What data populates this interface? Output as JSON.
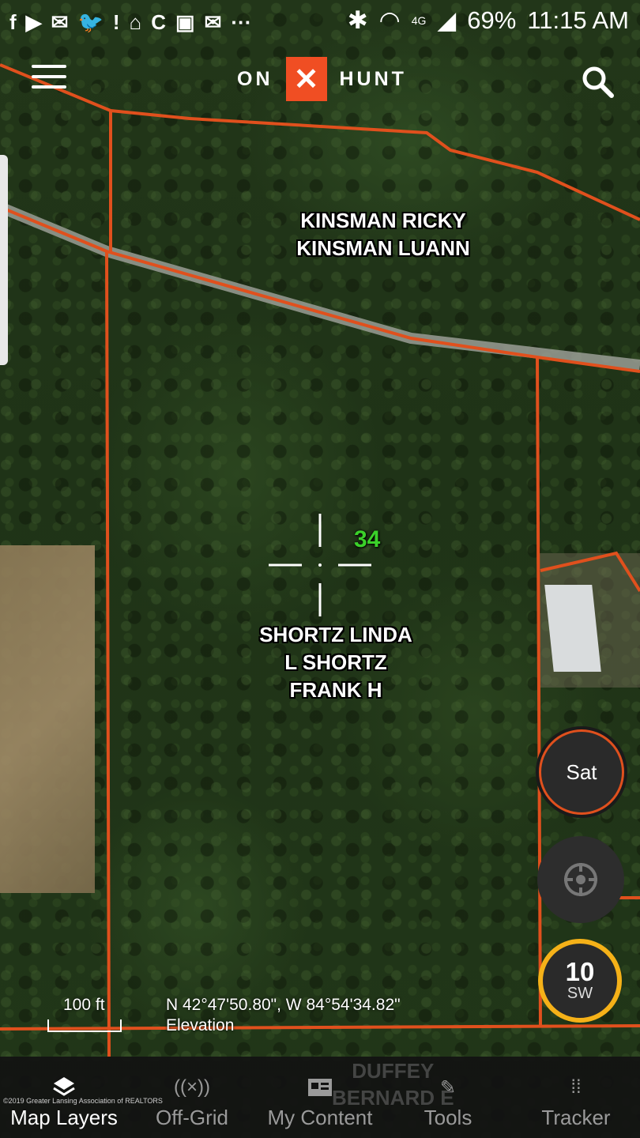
{
  "status_bar": {
    "battery": "69%",
    "time": "11:15 AM",
    "network": "4G",
    "more_icon": "···"
  },
  "header": {
    "logo_left": "ON",
    "logo_mark": "✕",
    "logo_right": "HUNT"
  },
  "parcels": [
    {
      "lines": [
        "KINSMAN RICKY",
        "KINSMAN LUANN"
      ]
    },
    {
      "lines": [
        "SHORTZ LINDA",
        "L SHORTZ",
        "FRANK H"
      ]
    }
  ],
  "section_number": "34",
  "controls": {
    "layer_button": "Sat",
    "compass_value": "10",
    "compass_dir": "SW"
  },
  "scale": {
    "label": "100 ft"
  },
  "location": {
    "coords": "N 42°47'50.80\", W 84°54'34.82\"",
    "elevation_label": "Elevation"
  },
  "background_labels": [
    "DUFFEY",
    "BERNARD E"
  ],
  "copyright": "©2019 Greater Lansing Association of REALTORS",
  "nav": [
    {
      "label": "Map Layers",
      "icon": "map-layers-icon"
    },
    {
      "label": "Off-Grid",
      "icon": "off-grid-icon"
    },
    {
      "label": "My Content",
      "icon": "my-content-icon"
    },
    {
      "label": "Tools",
      "icon": "tools-icon"
    },
    {
      "label": "Tracker",
      "icon": "tracker-icon"
    }
  ],
  "colors": {
    "boundary": "#e0501d",
    "accent": "#f04e23",
    "compass_ring": "#f5b118",
    "section_number": "#3bd12a"
  }
}
